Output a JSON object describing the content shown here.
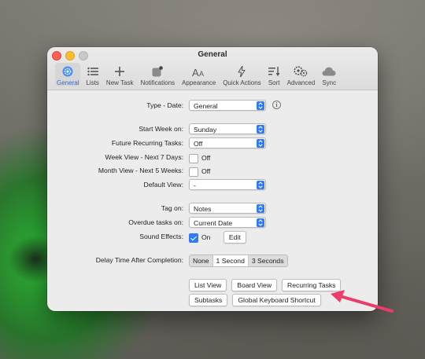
{
  "window": {
    "title": "General"
  },
  "toolbar": {
    "items": [
      {
        "label": "General",
        "icon": "gear-icon"
      },
      {
        "label": "Lists",
        "icon": "list-icon"
      },
      {
        "label": "New Task",
        "icon": "plus-icon"
      },
      {
        "label": "Notifications",
        "icon": "notification-icon"
      },
      {
        "label": "Appearance",
        "icon": "text-size-icon"
      },
      {
        "label": "Quick Actions",
        "icon": "bolt-icon"
      },
      {
        "label": "Sort",
        "icon": "sort-icon"
      },
      {
        "label": "Advanced",
        "icon": "gears-icon"
      },
      {
        "label": "Sync",
        "icon": "cloud-icon"
      }
    ]
  },
  "settings": {
    "type_date": {
      "label": "Type - Date:",
      "value": "General"
    },
    "start_week": {
      "label": "Start Week on:",
      "value": "Sunday"
    },
    "future_recurring": {
      "label": "Future Recurring Tasks:",
      "value": "Off"
    },
    "week_view": {
      "label": "Week View - Next 7 Days:",
      "value": "Off"
    },
    "month_view": {
      "label": "Month View - Next 5 Weeks:",
      "value": "Off"
    },
    "default_view": {
      "label": "Default View:",
      "value": "-"
    },
    "tag_on": {
      "label": "Tag on:",
      "value": "Notes"
    },
    "overdue": {
      "label": "Overdue tasks on:",
      "value": "Current Date"
    },
    "sound": {
      "label": "Sound Effects:",
      "value": "On",
      "edit_label": "Edit"
    },
    "delay": {
      "label": "Delay Time After Completion:",
      "options": [
        "None",
        "1 Second",
        "3 Seconds"
      ],
      "selected": "1 Second"
    }
  },
  "buttons": {
    "list_view": "List View",
    "board_view": "Board View",
    "recurring_tasks": "Recurring Tasks",
    "subtasks": "Subtasks",
    "global_shortcut": "Global Keyboard Shortcut"
  },
  "colors": {
    "accent": "#2f7bf5",
    "annotation_arrow": "#ec3c6c"
  }
}
